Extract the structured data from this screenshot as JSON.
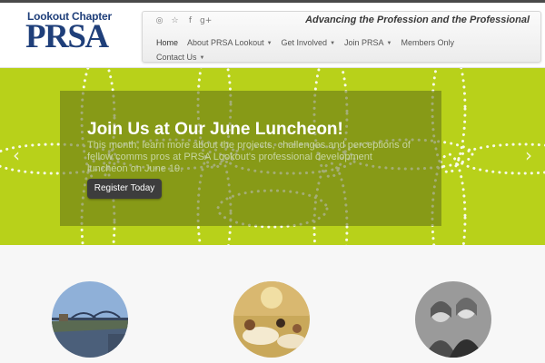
{
  "header": {
    "logo_top": "Lookout Chapter",
    "logo_main": "PRSA",
    "tagline": "Advancing the Profession and the Professional",
    "social": [
      {
        "icon": "rss-icon",
        "glyph": "◎"
      },
      {
        "icon": "twitter-icon",
        "glyph": "☆"
      },
      {
        "icon": "facebook-icon",
        "glyph": "f"
      },
      {
        "icon": "google-plus-icon",
        "glyph": "g+"
      }
    ]
  },
  "nav": {
    "items": [
      {
        "label": "Home",
        "dropdown": false,
        "active": true
      },
      {
        "label": "About PRSA Lookout",
        "dropdown": true
      },
      {
        "label": "Get Involved",
        "dropdown": true
      },
      {
        "label": "Join PRSA",
        "dropdown": true
      },
      {
        "label": "Members Only",
        "dropdown": false
      },
      {
        "label": "Contact Us",
        "dropdown": true
      }
    ]
  },
  "hero": {
    "title": "Join Us at Our June Luncheon!",
    "text": "This month, learn more about the projects, challenges and perceptions of fellow comms pros at PRSA Lookout's professional development luncheon on June 19.",
    "button": "Register Today",
    "prev_icon": "chevron-left-icon",
    "next_icon": "chevron-right-icon",
    "colors": {
      "background": "#b8d11a",
      "panel": "#5e6e16",
      "button": "#3d3d3d"
    }
  },
  "features": {
    "images": [
      {
        "icon": "bridge-photo"
      },
      {
        "icon": "luncheon-photo"
      },
      {
        "icon": "members-photo"
      }
    ]
  }
}
